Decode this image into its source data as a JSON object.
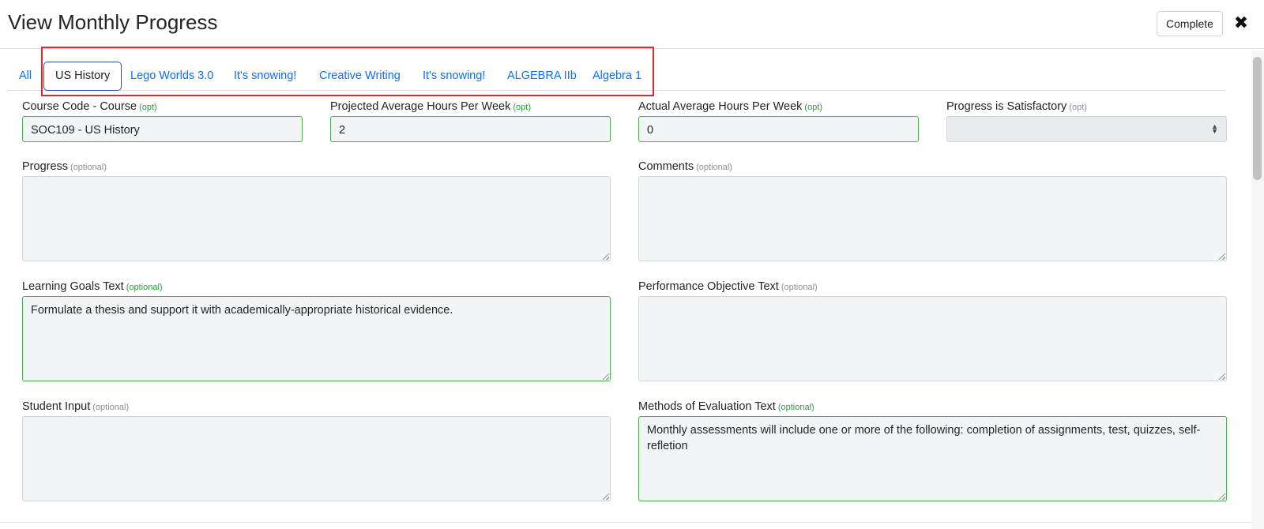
{
  "header": {
    "title": "View Monthly Progress",
    "complete_label": "Complete",
    "close_icon": "✖"
  },
  "tabs": [
    {
      "label": "All",
      "active": false
    },
    {
      "label": "US History",
      "active": true
    },
    {
      "label": "Lego Worlds 3.0",
      "active": false
    },
    {
      "label": "It's snowing!",
      "active": false
    },
    {
      "label": "Creative Writing",
      "active": false
    },
    {
      "label": "It's snowing!",
      "active": false
    },
    {
      "label": "ALGEBRA IIb",
      "active": false
    },
    {
      "label": "Algebra 1",
      "active": false
    }
  ],
  "fields": {
    "course_code": {
      "label": "Course Code - Course",
      "opt": "(opt)",
      "value": "SOC109 - US History"
    },
    "projected_hours": {
      "label": "Projected Average Hours Per Week",
      "opt": "(opt)",
      "value": "2"
    },
    "actual_hours": {
      "label": "Actual Average Hours Per Week",
      "opt": "(opt)",
      "value": "0"
    },
    "satisfactory": {
      "label": "Progress is Satisfactory",
      "opt": "(opt)",
      "value": ""
    },
    "progress": {
      "label": "Progress",
      "opt": "(optional)",
      "value": ""
    },
    "comments": {
      "label": "Comments",
      "opt": "(optional)",
      "value": ""
    },
    "learning_goals": {
      "label": "Learning Goals Text",
      "opt": "(optional)",
      "value": "Formulate a thesis and support it with academically-appropriate historical evidence."
    },
    "performance_objective": {
      "label": "Performance Objective Text",
      "opt": "(optional)",
      "value": ""
    },
    "student_input": {
      "label": "Student Input",
      "opt": "(optional)",
      "value": ""
    },
    "methods_evaluation": {
      "label": "Methods of Evaluation Text",
      "opt": "(optional)",
      "value": "Monthly assessments will include one or more of the following: completion of assignments, test, quizzes, self-refletion"
    }
  },
  "colors": {
    "link": "#0d6efd",
    "valid_border": "#4caf50",
    "highlight": "#e8262a"
  }
}
